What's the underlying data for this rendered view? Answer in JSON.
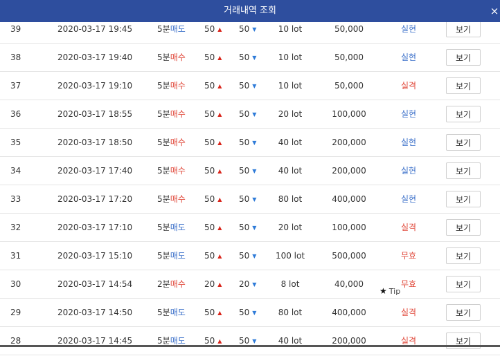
{
  "header": {
    "title": "거래내역 조회",
    "close_label": "×"
  },
  "colors": {
    "header_bg": "#2e4e9e",
    "buy": "#e0483a",
    "sell": "#3a6fc9",
    "up": "#d9261c",
    "down": "#2f7bd8"
  },
  "icons": {
    "up": "triangle-up-icon",
    "down": "triangle-down-icon",
    "tip": "star-icon",
    "close": "close-icon"
  },
  "rows": [
    {
      "no": "39",
      "datetime": "2020-03-17 19:45",
      "period": "5분",
      "side": "매도",
      "side_kind": "sell",
      "val_a": "50",
      "val_b": "50",
      "lot": "10 lot",
      "amount": "50,000",
      "result": "실현",
      "result_kind": "real",
      "button": "보기"
    },
    {
      "no": "38",
      "datetime": "2020-03-17 19:40",
      "period": "5분",
      "side": "매수",
      "side_kind": "buy",
      "val_a": "50",
      "val_b": "50",
      "lot": "10 lot",
      "amount": "50,000",
      "result": "실현",
      "result_kind": "real",
      "button": "보기"
    },
    {
      "no": "37",
      "datetime": "2020-03-17 19:10",
      "period": "5분",
      "side": "매수",
      "side_kind": "buy",
      "val_a": "50",
      "val_b": "50",
      "lot": "10 lot",
      "amount": "50,000",
      "result": "실격",
      "result_kind": "fail",
      "button": "보기"
    },
    {
      "no": "36",
      "datetime": "2020-03-17 18:55",
      "period": "5분",
      "side": "매수",
      "side_kind": "buy",
      "val_a": "50",
      "val_b": "50",
      "lot": "20 lot",
      "amount": "100,000",
      "result": "실현",
      "result_kind": "real",
      "button": "보기"
    },
    {
      "no": "35",
      "datetime": "2020-03-17 18:50",
      "period": "5분",
      "side": "매수",
      "side_kind": "buy",
      "val_a": "50",
      "val_b": "50",
      "lot": "40 lot",
      "amount": "200,000",
      "result": "실현",
      "result_kind": "real",
      "button": "보기"
    },
    {
      "no": "34",
      "datetime": "2020-03-17 17:40",
      "period": "5분",
      "side": "매수",
      "side_kind": "buy",
      "val_a": "50",
      "val_b": "50",
      "lot": "40 lot",
      "amount": "200,000",
      "result": "실현",
      "result_kind": "real",
      "button": "보기"
    },
    {
      "no": "33",
      "datetime": "2020-03-17 17:20",
      "period": "5분",
      "side": "매수",
      "side_kind": "buy",
      "val_a": "50",
      "val_b": "50",
      "lot": "80 lot",
      "amount": "400,000",
      "result": "실현",
      "result_kind": "real",
      "button": "보기"
    },
    {
      "no": "32",
      "datetime": "2020-03-17 17:10",
      "period": "5분",
      "side": "매도",
      "side_kind": "sell",
      "val_a": "50",
      "val_b": "50",
      "lot": "20 lot",
      "amount": "100,000",
      "result": "실격",
      "result_kind": "fail",
      "button": "보기"
    },
    {
      "no": "31",
      "datetime": "2020-03-17 15:10",
      "period": "5분",
      "side": "매도",
      "side_kind": "sell",
      "val_a": "50",
      "val_b": "50",
      "lot": "100 lot",
      "amount": "500,000",
      "result": "무효",
      "result_kind": "void",
      "button": "보기"
    },
    {
      "no": "30",
      "datetime": "2020-03-17 14:54",
      "period": "2분",
      "side": "매수",
      "side_kind": "buy",
      "val_a": "20",
      "val_b": "20",
      "lot": "8 lot",
      "amount": "40,000",
      "result": "무효",
      "result_kind": "void",
      "button": "보기"
    },
    {
      "no": "29",
      "datetime": "2020-03-17 14:50",
      "period": "5분",
      "side": "매도",
      "side_kind": "sell",
      "val_a": "50",
      "val_b": "50",
      "lot": "80 lot",
      "amount": "400,000",
      "result": "실격",
      "result_kind": "fail",
      "button": "보기"
    },
    {
      "no": "28",
      "datetime": "2020-03-17 14:45",
      "period": "5분",
      "side": "매도",
      "side_kind": "sell",
      "val_a": "50",
      "val_b": "50",
      "lot": "40 lot",
      "amount": "200,000",
      "result": "실격",
      "result_kind": "fail",
      "button": "보기"
    }
  ],
  "tip": {
    "label": "Tip"
  }
}
